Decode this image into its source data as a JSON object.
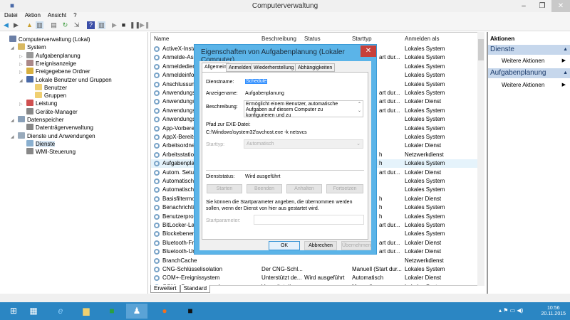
{
  "window": {
    "title": "Computerverwaltung"
  },
  "menu": [
    "Datei",
    "Aktion",
    "Ansicht",
    "?"
  ],
  "tree": [
    {
      "label": "Computerverwaltung (Lokal)",
      "level": 0,
      "expander": "",
      "color": "#6b7fa6"
    },
    {
      "label": "System",
      "level": 1,
      "expander": "◢",
      "color": "#d8b860"
    },
    {
      "label": "Aufgabenplanung",
      "level": 2,
      "expander": "▷",
      "color": "#999"
    },
    {
      "label": "Ereignisanzeige",
      "level": 2,
      "expander": "▷",
      "color": "#a88"
    },
    {
      "label": "Freigegebene Ordner",
      "level": 2,
      "expander": "▷",
      "color": "#d8b040"
    },
    {
      "label": "Lokale Benutzer und Gruppen",
      "level": 2,
      "expander": "◢",
      "color": "#4a6aa8"
    },
    {
      "label": "Benutzer",
      "level": 3,
      "expander": "",
      "color": "#f0cf70"
    },
    {
      "label": "Gruppen",
      "level": 3,
      "expander": "",
      "color": "#f0cf70"
    },
    {
      "label": "Leistung",
      "level": 2,
      "expander": "▷",
      "color": "#d05050"
    },
    {
      "label": "Geräte-Manager",
      "level": 2,
      "expander": "",
      "color": "#888"
    },
    {
      "label": "Datenspeicher",
      "level": 1,
      "expander": "◢",
      "color": "#8aa0b8"
    },
    {
      "label": "Datenträgerverwaltung",
      "level": 2,
      "expander": "",
      "color": "#888"
    },
    {
      "label": "Dienste und Anwendungen",
      "level": 1,
      "expander": "◢",
      "color": "#9ab"
    },
    {
      "label": "Dienste",
      "level": 2,
      "expander": "",
      "color": "#8ab0d0",
      "selected": true
    },
    {
      "label": "WMI-Steuerung",
      "level": 2,
      "expander": "",
      "color": "#888"
    }
  ],
  "list": {
    "headers": [
      "Name",
      "Beschreibung",
      "Status",
      "Starttyp",
      "Anmelden als"
    ],
    "rows": [
      {
        "name": "ActiveX-Insta",
        "desc": "",
        "status": "",
        "start": "",
        "logon": "Lokales System"
      },
      {
        "name": "Anmelde-Ass",
        "desc": "",
        "status": "",
        "start": "art dur...",
        "logon": "Lokales System"
      },
      {
        "name": "Anmeldedien",
        "desc": "",
        "status": "",
        "start": "",
        "logon": "Lokales System"
      },
      {
        "name": "Anmeldeinfo",
        "desc": "",
        "status": "",
        "start": "",
        "logon": "Lokales System"
      },
      {
        "name": "Anschlussum",
        "desc": "",
        "status": "",
        "start": "",
        "logon": "Lokales System"
      },
      {
        "name": "Anwendungs",
        "desc": "",
        "status": "",
        "start": "art dur...",
        "logon": "Lokales System"
      },
      {
        "name": "Anwendungs",
        "desc": "",
        "status": "",
        "start": "art dur...",
        "logon": "Lokaler Dienst"
      },
      {
        "name": "Anwendungs",
        "desc": "",
        "status": "",
        "start": "art dur...",
        "logon": "Lokales System"
      },
      {
        "name": "Anwendungs",
        "desc": "",
        "status": "",
        "start": "",
        "logon": "Lokales System"
      },
      {
        "name": "App-Vorbere",
        "desc": "",
        "status": "",
        "start": "",
        "logon": "Lokales System"
      },
      {
        "name": "AppX-Bereits",
        "desc": "",
        "status": "",
        "start": "",
        "logon": "Lokales System"
      },
      {
        "name": "Arbeitsordne",
        "desc": "",
        "status": "",
        "start": "",
        "logon": "Lokaler Dienst"
      },
      {
        "name": "Arbeitsstation",
        "desc": "",
        "status": "",
        "start": "h",
        "logon": "Netzwerkdienst"
      },
      {
        "name": "Aufgabenpla",
        "desc": "",
        "status": "",
        "start": "h",
        "logon": "Lokales System",
        "selected": true
      },
      {
        "name": "Autom. Setup",
        "desc": "",
        "status": "",
        "start": "art dur...",
        "logon": "Lokaler Dienst"
      },
      {
        "name": "Automatisch",
        "desc": "",
        "status": "",
        "start": "",
        "logon": "Lokales System"
      },
      {
        "name": "Automatisch",
        "desc": "",
        "status": "",
        "start": "",
        "logon": "Lokales System"
      },
      {
        "name": "Basisfiltermo",
        "desc": "",
        "status": "",
        "start": "h",
        "logon": "Lokaler Dienst"
      },
      {
        "name": "Benachrichti",
        "desc": "",
        "status": "",
        "start": "h",
        "logon": "Lokales System"
      },
      {
        "name": "Benutzerprof",
        "desc": "",
        "status": "",
        "start": "h",
        "logon": "Lokales System"
      },
      {
        "name": "BitLocker-La",
        "desc": "",
        "status": "",
        "start": "art dur...",
        "logon": "Lokales System"
      },
      {
        "name": "Blockebenen",
        "desc": "",
        "status": "",
        "start": "",
        "logon": "Lokales System"
      },
      {
        "name": "Bluetooth-Fr",
        "desc": "",
        "status": "",
        "start": "art dur...",
        "logon": "Lokaler Dienst"
      },
      {
        "name": "Bluetooth-Ur",
        "desc": "",
        "status": "",
        "start": "art dur...",
        "logon": "Lokaler Dienst"
      },
      {
        "name": "BranchCache",
        "desc": "",
        "status": "",
        "start": "",
        "logon": "Netzwerkdienst"
      },
      {
        "name": "CNG-Schlüsselisolation",
        "desc": "Der CNG-Schl...",
        "status": "",
        "start": "Manuell (Start dur...",
        "logon": "Lokales System",
        "full": true
      },
      {
        "name": "COM+-Ereignissystem",
        "desc": "Unterstützt de...",
        "status": "Wird ausgeführt",
        "start": "Automatisch",
        "logon": "Lokaler Dienst",
        "full": true
      },
      {
        "name": "COM+-Systemanwendung",
        "desc": "Verwaltet die ...",
        "status": "",
        "start": "Manuell",
        "logon": "Lokales System",
        "full": true
      }
    ]
  },
  "view_tabs": [
    "Erweitert",
    "Standard"
  ],
  "actions": {
    "title": "Aktionen",
    "groups": [
      {
        "title": "Dienste",
        "item": "Weitere Aktionen"
      },
      {
        "title": "Aufgabenplanung",
        "item": "Weitere Aktionen"
      }
    ]
  },
  "dialog": {
    "title": "Eigenschaften von Aufgabenplanung (Lokaler Computer)",
    "tabs": [
      "Allgemein",
      "Anmelden",
      "Wiederherstellung",
      "Abhängigkeiten"
    ],
    "service_name_label": "Dienstname:",
    "service_name": "Schedule",
    "display_name_label": "Anzeigename:",
    "display_name": "Aufgabenplanung",
    "description_label": "Beschreibung:",
    "description": "Ermöglicht einem Benutzer, automatische Aufgaben auf diesem Computer zu konfigurieren und zu",
    "path_label": "Pfad zur EXE-Datei:",
    "path": "C:\\Windows\\system32\\svchost.exe -k netsvcs",
    "starttype_label": "Starttyp:",
    "starttype": "Automatisch",
    "status_label": "Dienststatus:",
    "status": "Wird ausgeführt",
    "control_buttons": [
      "Starten",
      "Beenden",
      "Anhalten",
      "Fortsetzen"
    ],
    "params_hint": "Sie können die Startparameter angeben, die übernommen werden sollen, wenn der Dienst von hier aus gestartet wird.",
    "params_label": "Startparameter:",
    "params_value": "",
    "ok": "OK",
    "cancel": "Abbrechen",
    "apply": "Übernehmen"
  },
  "taskbar": {
    "time": "10:56",
    "date": "20.11.2015",
    "accent": "#2b86c3"
  }
}
